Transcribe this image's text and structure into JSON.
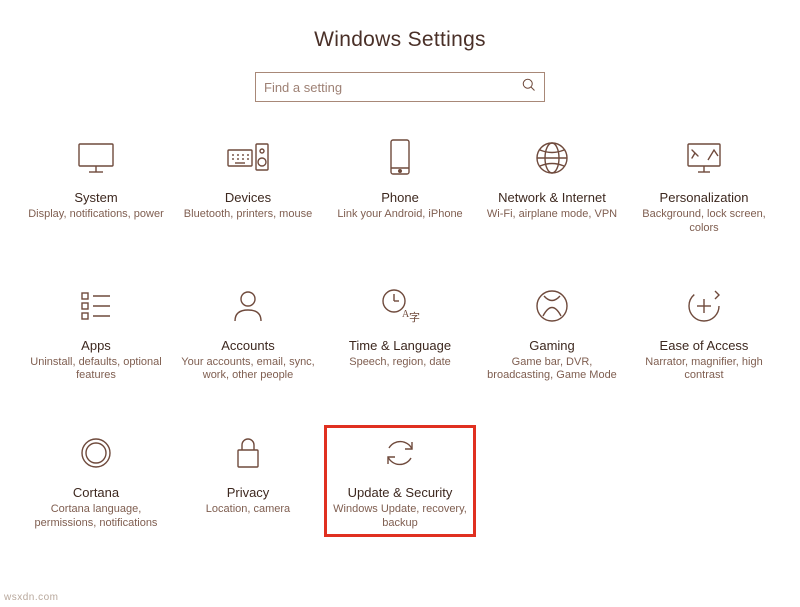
{
  "header": {
    "title": "Windows Settings"
  },
  "search": {
    "placeholder": "Find a setting"
  },
  "categories": [
    {
      "title": "System",
      "desc": "Display, notifications, power"
    },
    {
      "title": "Devices",
      "desc": "Bluetooth, printers, mouse"
    },
    {
      "title": "Phone",
      "desc": "Link your Android, iPhone"
    },
    {
      "title": "Network & Internet",
      "desc": "Wi-Fi, airplane mode, VPN"
    },
    {
      "title": "Personalization",
      "desc": "Background, lock screen, colors"
    },
    {
      "title": "Apps",
      "desc": "Uninstall, defaults, optional features"
    },
    {
      "title": "Accounts",
      "desc": "Your accounts, email, sync, work, other people"
    },
    {
      "title": "Time & Language",
      "desc": "Speech, region, date"
    },
    {
      "title": "Gaming",
      "desc": "Game bar, DVR, broadcasting, Game Mode"
    },
    {
      "title": "Ease of Access",
      "desc": "Narrator, magnifier, high contrast"
    },
    {
      "title": "Cortana",
      "desc": "Cortana language, permissions, notifications"
    },
    {
      "title": "Privacy",
      "desc": "Location, camera"
    },
    {
      "title": "Update & Security",
      "desc": "Windows Update, recovery, backup"
    }
  ],
  "watermark": "wsxdn.com"
}
